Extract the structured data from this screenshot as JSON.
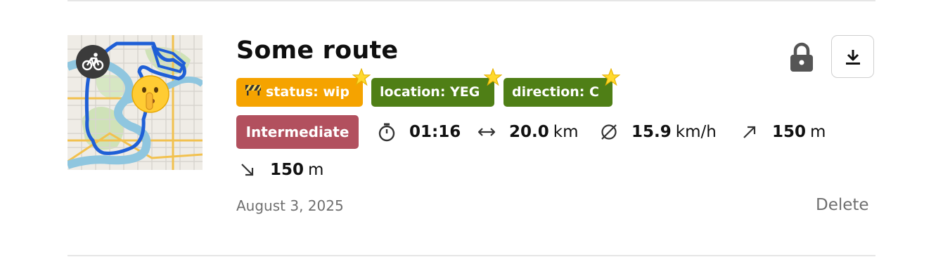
{
  "route": {
    "title": "Some route",
    "date": "August 3, 2025",
    "delete_label": "Delete",
    "difficulty": "Intermediate",
    "tags": [
      {
        "label": "status: wip",
        "color": "#f5a300",
        "icon": "construction-barrier-icon"
      },
      {
        "label": "location: YEG",
        "color": "#4f7f16"
      },
      {
        "label": "direction: C",
        "color": "#4f7f16"
      }
    ],
    "stats": {
      "duration": {
        "value": "01:16",
        "icon": "stopwatch-icon"
      },
      "distance": {
        "value": "20.0",
        "unit": "km",
        "icon": "distance-arrows-icon"
      },
      "avg_speed": {
        "value": "15.9",
        "unit": "km/h",
        "icon": "average-speed-icon"
      },
      "ascent": {
        "value": "150",
        "unit": "m",
        "icon": "ascent-arrow-icon"
      },
      "descent": {
        "value": "150",
        "unit": "m",
        "icon": "descent-arrow-icon"
      }
    },
    "thumbnail": {
      "activity_icon": "bicycle-icon",
      "privacy_emoji": "shushing-face-icon"
    },
    "actions": {
      "private_icon": "lock-icon",
      "download_icon": "download-icon"
    }
  },
  "colors": {
    "wip": "#f5a300",
    "green_tag": "#4f7f16",
    "difficulty": "#b2505e",
    "route_line": "#1f5fd6",
    "muted_text": "#6f6f6f"
  }
}
